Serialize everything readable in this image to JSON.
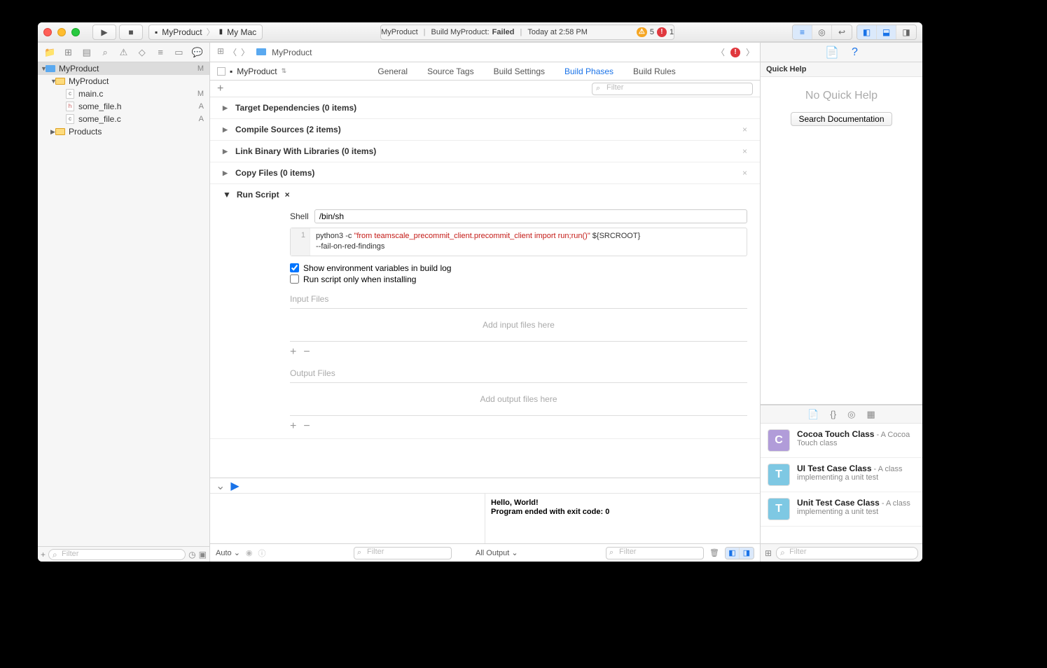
{
  "titlebar": {
    "scheme_target": "MyProduct",
    "scheme_device": "My Mac",
    "status_project": "MyProduct",
    "status_build_prefix": "Build MyProduct: ",
    "status_build_result": "Failed",
    "status_time": "Today at 2:58 PM",
    "warn_count": "5",
    "err_count": "1"
  },
  "navigator": {
    "project": "MyProduct",
    "project_status": "M",
    "group": "MyProduct",
    "files": [
      {
        "name": "main.c",
        "ext": "c",
        "status": "M"
      },
      {
        "name": "some_file.h",
        "ext": "h",
        "status": "A"
      },
      {
        "name": "some_file.c",
        "ext": "c",
        "status": "A"
      }
    ],
    "products": "Products",
    "filter_placeholder": "Filter"
  },
  "crumbs": {
    "item": "MyProduct"
  },
  "tabs": {
    "target": "MyProduct",
    "items": [
      "General",
      "Source Tags",
      "Build Settings",
      "Build Phases",
      "Build Rules"
    ],
    "active": "Build Phases"
  },
  "phasefilter_placeholder": "Filter",
  "phases": {
    "target_deps": "Target Dependencies (0 items)",
    "compile": "Compile Sources (2 items)",
    "link": "Link Binary With Libraries (0 items)",
    "copy": "Copy Files (0 items)",
    "runscript": "Run Script"
  },
  "runscript": {
    "shell_label": "Shell",
    "shell_value": "/bin/sh",
    "line_no": "1",
    "code_pre": "python3 -c ",
    "code_str": "\"from teamscale_precommit_client.precommit_client import run;run()\"",
    "code_post": " ${SRCROOT}",
    "code_indent": "    --fail-on-red-findings",
    "check1": "Show environment variables in build log",
    "check2": "Run script only when installing",
    "input_files_label": "Input Files",
    "input_files_hint": "Add input files here",
    "output_files_label": "Output Files",
    "output_files_hint": "Add output files here"
  },
  "console": {
    "line1": "Hello, World!",
    "line2": "Program ended with exit code: 0",
    "auto": "Auto",
    "alloutput": "All Output",
    "filter_placeholder": "Filter"
  },
  "inspector": {
    "quickhelp_label": "Quick Help",
    "noquickhelp": "No Quick Help",
    "search_docs": "Search Documentation",
    "lib": [
      {
        "icon": "C",
        "iconclass": "purple",
        "title": "Cocoa Touch Class",
        "desc": " - A Cocoa Touch class"
      },
      {
        "icon": "T",
        "iconclass": "blue",
        "title": "UI Test Case Class",
        "desc": " - A class implementing a unit test"
      },
      {
        "icon": "T",
        "iconclass": "blue",
        "title": "Unit Test Case Class",
        "desc": " - A class implementing a unit test"
      }
    ],
    "filter_placeholder": "Filter"
  }
}
